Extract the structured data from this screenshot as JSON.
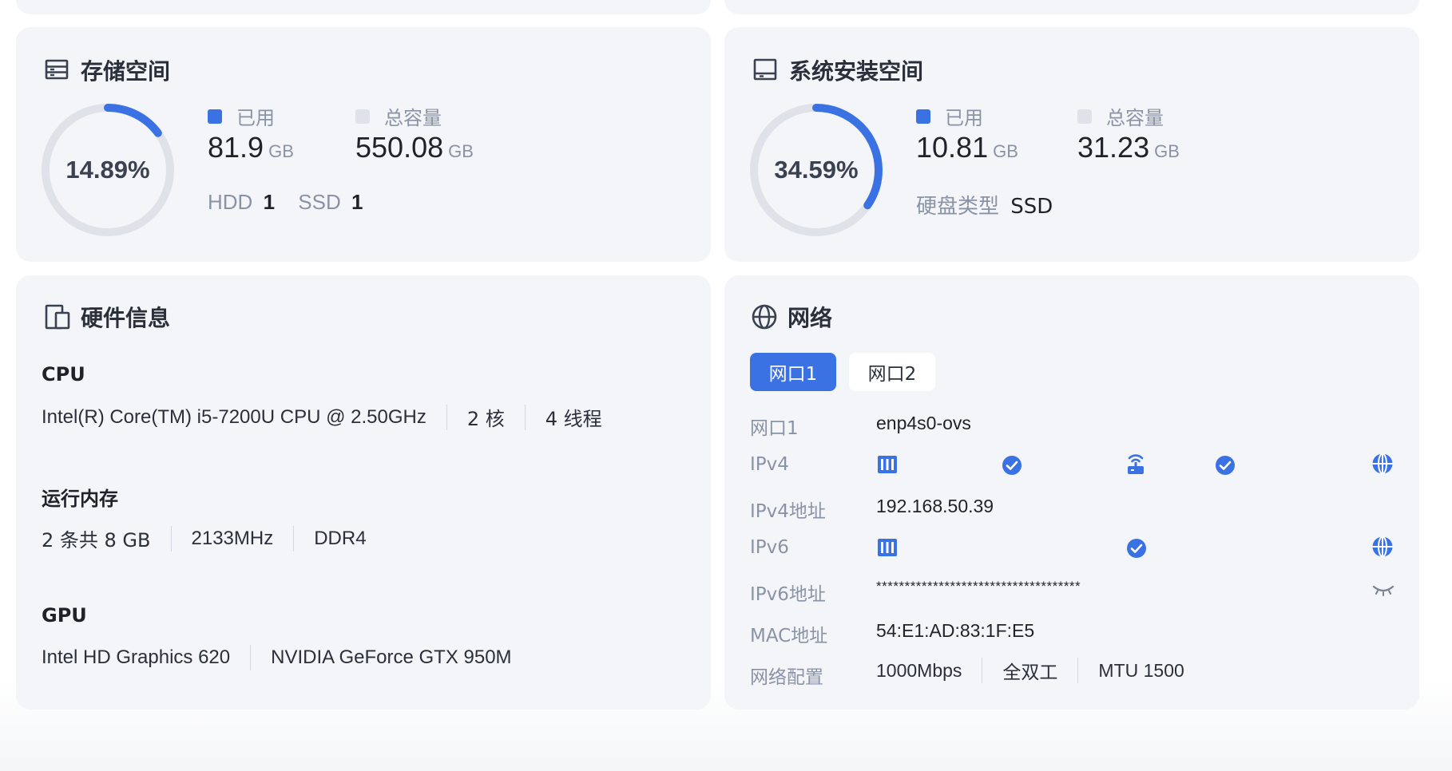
{
  "storage": {
    "title": "存储空间",
    "percent_text": "14.89%",
    "percent": 0.1489,
    "used_label": "已用",
    "used_value": "81.9",
    "used_unit": "GB",
    "total_label": "总容量",
    "total_value": "550.08",
    "total_unit": "GB",
    "hdd_label": "HDD",
    "hdd_count": "1",
    "ssd_label": "SSD",
    "ssd_count": "1"
  },
  "system_storage": {
    "title": "系统安装空间",
    "percent_text": "34.59%",
    "percent": 0.3459,
    "used_label": "已用",
    "used_value": "10.81",
    "used_unit": "GB",
    "total_label": "总容量",
    "total_value": "31.23",
    "total_unit": "GB",
    "disk_type_label": "硬盘类型",
    "disk_type_value": "SSD"
  },
  "hardware": {
    "title": "硬件信息",
    "cpu_label": "CPU",
    "cpu_model": "Intel(R) Core(TM) i5-7200U CPU @ 2.50GHz",
    "cpu_cores": "2 核",
    "cpu_threads": "4 线程",
    "memory_label": "运行内存",
    "memory_size": "2 条共 8 GB",
    "memory_freq": "2133MHz",
    "memory_type": "DDR4",
    "gpu_label": "GPU",
    "gpu_1": "Intel HD Graphics 620",
    "gpu_2": "NVIDIA GeForce GTX 950M"
  },
  "network": {
    "title": "网络",
    "tabs": [
      "网口1",
      "网口2"
    ],
    "port_label": "网口1",
    "port_value": "enp4s0-ovs",
    "ipv4_label": "IPv4",
    "ipv4_addr_label": "IPv4地址",
    "ipv4_addr_value": "192.168.50.39",
    "ipv6_label": "IPv6",
    "ipv6_addr_label": "IPv6地址",
    "ipv6_addr_value": "************************************",
    "mac_label": "MAC地址",
    "mac_value": "54:E1:AD:83:1F:E5",
    "config_label": "网络配置",
    "config_speed": "1000Mbps",
    "config_duplex": "全双工",
    "config_mtu": "MTU 1500"
  },
  "colors": {
    "accent": "#3b72e3",
    "ring_track": "#dfe2e8",
    "card_bg": "#f3f5f8",
    "muted_text": "#8a93a6",
    "legend_total": "#dfe2e8"
  },
  "icons": [
    "storage-icon",
    "drive-icon",
    "devices-icon",
    "globe-icon",
    "server-icon",
    "router-icon",
    "check-icon",
    "eye-closed-icon"
  ]
}
